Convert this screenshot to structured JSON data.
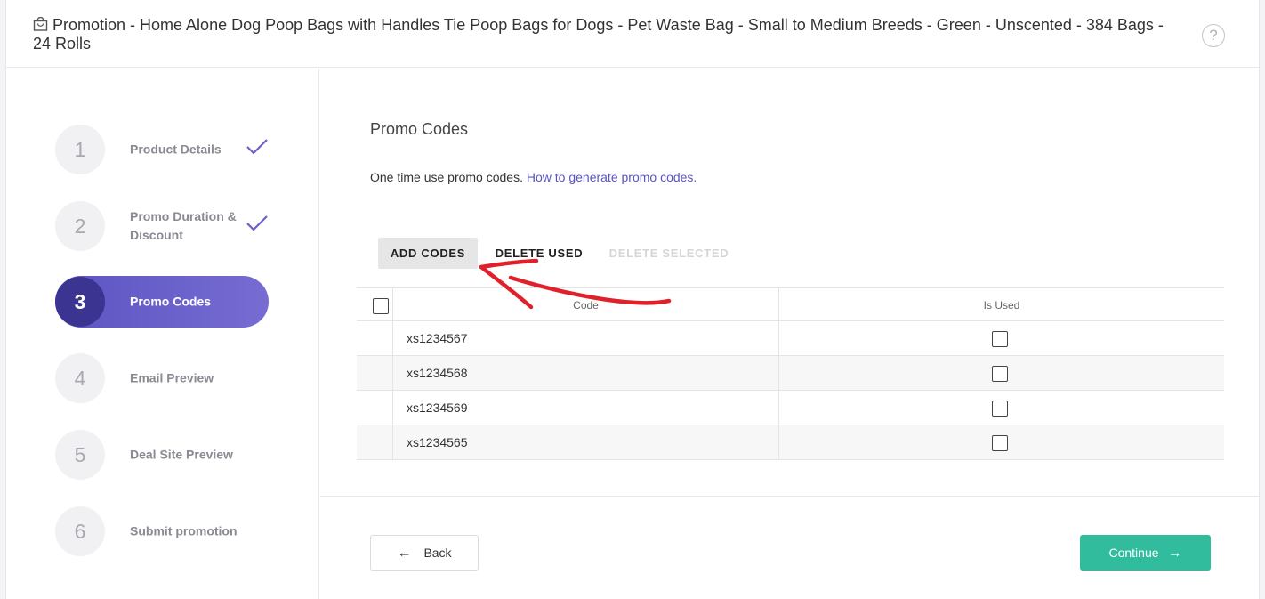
{
  "header": {
    "title": "Promotion - Home Alone Dog Poop Bags with Handles Tie Poop Bags for Dogs - Pet Waste Bag - Small to Medium Breeds - Green - Unscented - 384 Bags - 24 Rolls",
    "title_icon": "shopping-bag-icon",
    "help_icon": "help-circle-icon",
    "help_glyph": "?"
  },
  "steps": [
    {
      "number": "1",
      "label": "Product Details",
      "completed": true
    },
    {
      "number": "2",
      "label": "Promo Duration & Discount",
      "completed": true
    },
    {
      "number": "3",
      "label": "Promo Codes",
      "active": true
    },
    {
      "number": "4",
      "label": "Email Preview"
    },
    {
      "number": "5",
      "label": "Deal Site Preview"
    },
    {
      "number": "6",
      "label": "Submit promotion"
    }
  ],
  "main": {
    "section_title": "Promo Codes",
    "description": "One time use promo codes.",
    "help_link": "How to generate promo codes."
  },
  "toolbar": {
    "add_codes": "ADD CODES",
    "delete_used": "DELETE USED",
    "delete_selected": "DELETE SELECTED"
  },
  "table": {
    "columns": {
      "code": "Code",
      "is_used": "Is Used"
    },
    "rows": [
      {
        "code": "xs1234567",
        "is_used": false
      },
      {
        "code": "xs1234568",
        "is_used": false
      },
      {
        "code": "xs1234569",
        "is_used": false
      },
      {
        "code": "xs1234565",
        "is_used": false
      }
    ]
  },
  "footer": {
    "back": "Back",
    "continue": "Continue"
  },
  "colors": {
    "accent": "#5d54c2",
    "accent_dark": "#3b3491",
    "continue": "#30bc9d",
    "annotation": "#e0202a"
  }
}
